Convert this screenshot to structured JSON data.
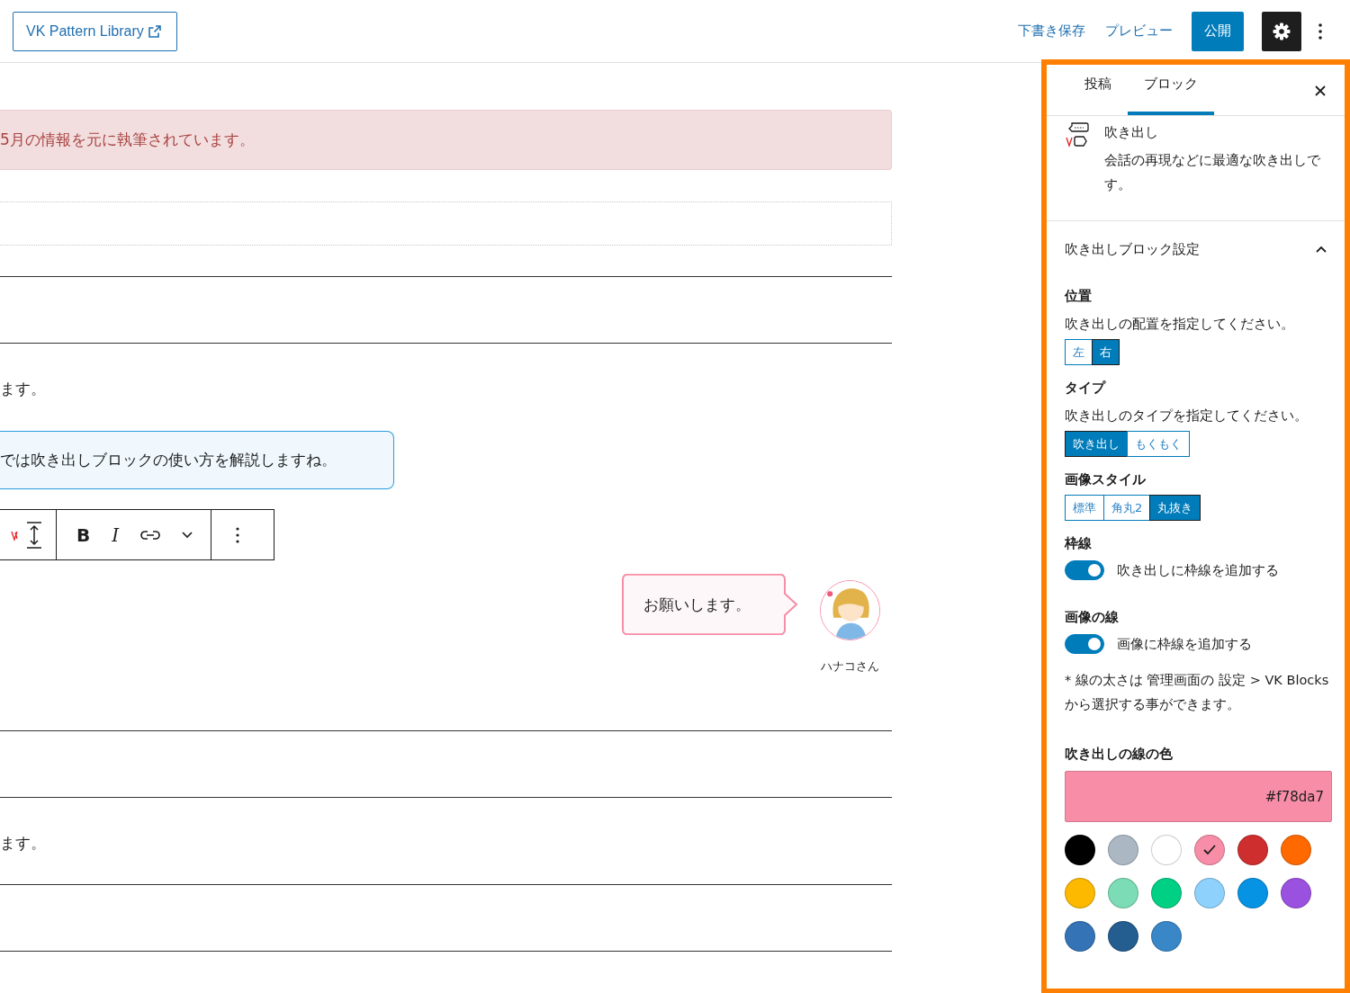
{
  "header": {
    "library_button": "VK Pattern Library",
    "actions": [
      {
        "label": "下書き保存",
        "kind": "link"
      },
      {
        "label": "プレビュー",
        "kind": "link"
      },
      {
        "label": "公開",
        "kind": "primary"
      }
    ],
    "settings_selected": true
  },
  "canvas": {
    "blocks": [
      {
        "kind": "gap"
      },
      {
        "kind": "alert",
        "text": "5月の情報を元に執筆されています。"
      },
      {
        "kind": "placeholder"
      },
      {
        "kind": "separator"
      },
      {
        "kind": "separator"
      },
      {
        "kind": "paragraph",
        "text": "ます。"
      },
      {
        "kind": "balloon",
        "align_right": false,
        "text": "では吹き出しブロックの使い方を解説しますね。",
        "color": "#2a9be0"
      },
      {
        "kind": "toolbar",
        "bold": "B",
        "italic": "I"
      },
      {
        "kind": "balloon",
        "align_right": true,
        "text": "お願いします。",
        "speaker": "ハナコさん",
        "color": "#f78da7",
        "image_border": true
      },
      {
        "kind": "separator"
      },
      {
        "kind": "separator"
      },
      {
        "kind": "paragraph",
        "text": "ます。"
      },
      {
        "kind": "separator"
      },
      {
        "kind": "separator"
      }
    ]
  },
  "sidebar": {
    "tabs": [
      {
        "label": "投稿",
        "selected": false
      },
      {
        "label": "ブロック",
        "selected": true
      }
    ],
    "block_card": {
      "title": "吹き出し",
      "description": "会話の再現などに最適な吹き出しです。"
    },
    "panel": {
      "title": "吹き出しブロック設定",
      "expanded": true,
      "sections": [
        {
          "kind": "segmented",
          "heading": "位置",
          "help": "吹き出しの配置を指定してください。",
          "options": [
            {
              "label": "左",
              "selected": false
            },
            {
              "label": "右",
              "selected": true
            }
          ]
        },
        {
          "kind": "segmented",
          "heading": "タイプ",
          "help": "吹き出しのタイプを指定してください。",
          "options": [
            {
              "label": "吹き出し",
              "selected": true
            },
            {
              "label": "もくもく",
              "selected": false
            }
          ]
        },
        {
          "kind": "segmented",
          "heading": "画像スタイル",
          "options": [
            {
              "label": "標準",
              "selected": false
            },
            {
              "label": "角丸2",
              "selected": false
            },
            {
              "label": "丸抜き",
              "selected": true
            }
          ]
        },
        {
          "kind": "toggle",
          "heading": "枠線",
          "label": "吹き出しに枠線を追加する",
          "on": true
        },
        {
          "kind": "toggle",
          "heading": "画像の線",
          "label": "画像に枠線を追加する",
          "on": true,
          "note": "* 線の太さは 管理画面の 設定 > VK Blocks から選択する事ができます。"
        },
        {
          "kind": "color",
          "heading": "吹き出しの線の色",
          "value": "#f78da7",
          "swatches": [
            {
              "color": "#000000",
              "selected": false
            },
            {
              "color": "#abb8c3",
              "selected": false
            },
            {
              "color": "#ffffff",
              "selected": false
            },
            {
              "color": "#f78da7",
              "selected": true
            },
            {
              "color": "#cf2e2e",
              "selected": false
            },
            {
              "color": "#ff6900",
              "selected": false
            },
            {
              "color": "#fcb900",
              "selected": false
            },
            {
              "color": "#7bdcb5",
              "selected": false
            },
            {
              "color": "#00d084",
              "selected": false
            },
            {
              "color": "#8ed1fc",
              "selected": false
            },
            {
              "color": "#0693e3",
              "selected": false
            },
            {
              "color": "#9b51e0",
              "selected": false
            },
            {
              "color": "#3373b6",
              "selected": false
            },
            {
              "color": "#245d8f",
              "selected": false
            },
            {
              "color": "#3a87c8",
              "selected": false
            }
          ]
        }
      ]
    }
  }
}
